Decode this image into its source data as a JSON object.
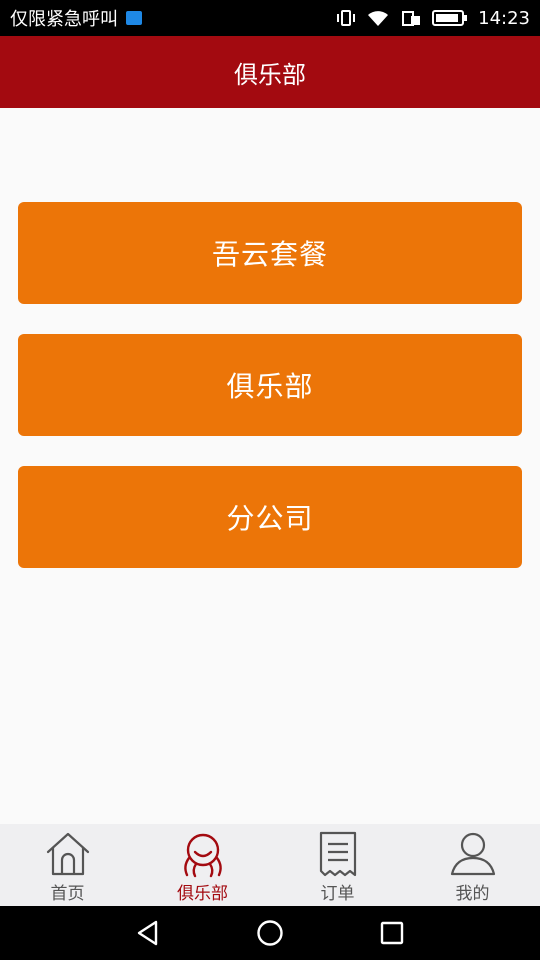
{
  "status_bar": {
    "carrier_text": "仅限紧急呼叫",
    "time": "14:23",
    "icons": [
      "sim-notification-icon",
      "vibrate-icon",
      "wifi-icon",
      "data-icon",
      "battery-icon"
    ]
  },
  "header": {
    "title": "俱乐部"
  },
  "menu": {
    "items": [
      {
        "label": "吾云套餐"
      },
      {
        "label": "俱乐部"
      },
      {
        "label": "分公司"
      }
    ]
  },
  "tabs": [
    {
      "label": "首页",
      "icon": "home-icon",
      "active": false
    },
    {
      "label": "俱乐部",
      "icon": "club-icon",
      "active": true
    },
    {
      "label": "订单",
      "icon": "order-icon",
      "active": false
    },
    {
      "label": "我的",
      "icon": "profile-icon",
      "active": false
    }
  ],
  "colors": {
    "header_bg": "#a30a10",
    "button_bg": "#ec7508",
    "active_tab": "#a30a10",
    "inactive_tab": "#555555",
    "tab_bar_bg": "#efeff1"
  },
  "system_nav": [
    "back-icon",
    "home-circle-icon",
    "recents-icon"
  ]
}
